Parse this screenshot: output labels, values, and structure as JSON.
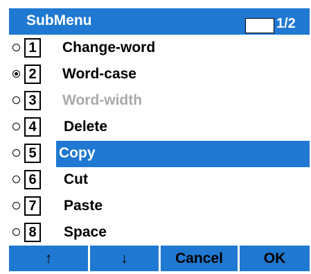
{
  "header": {
    "title": "SubMenu",
    "page": "1/2"
  },
  "menu": {
    "items": [
      {
        "number": "1",
        "label": "Change-word",
        "selected": false,
        "disabled": false,
        "highlighted": false
      },
      {
        "number": "2",
        "label": "Word-case",
        "selected": true,
        "disabled": false,
        "highlighted": false
      },
      {
        "number": "3",
        "label": "Word-width",
        "selected": false,
        "disabled": true,
        "highlighted": false
      },
      {
        "number": "4",
        "label": "Delete",
        "selected": false,
        "disabled": false,
        "highlighted": false
      },
      {
        "number": "5",
        "label": "Copy",
        "selected": false,
        "disabled": false,
        "highlighted": true
      },
      {
        "number": "6",
        "label": "Cut",
        "selected": false,
        "disabled": false,
        "highlighted": false
      },
      {
        "number": "7",
        "label": "Paste",
        "selected": false,
        "disabled": false,
        "highlighted": false
      },
      {
        "number": "8",
        "label": "Space",
        "selected": false,
        "disabled": false,
        "highlighted": false
      }
    ]
  },
  "softkeys": {
    "up": "↑",
    "down": "↓",
    "cancel": "Cancel",
    "ok": "OK"
  },
  "colors": {
    "accent": "#1f78d1",
    "text": "#000000",
    "disabled_text": "#a9a9a9",
    "background": "#ffffff"
  }
}
